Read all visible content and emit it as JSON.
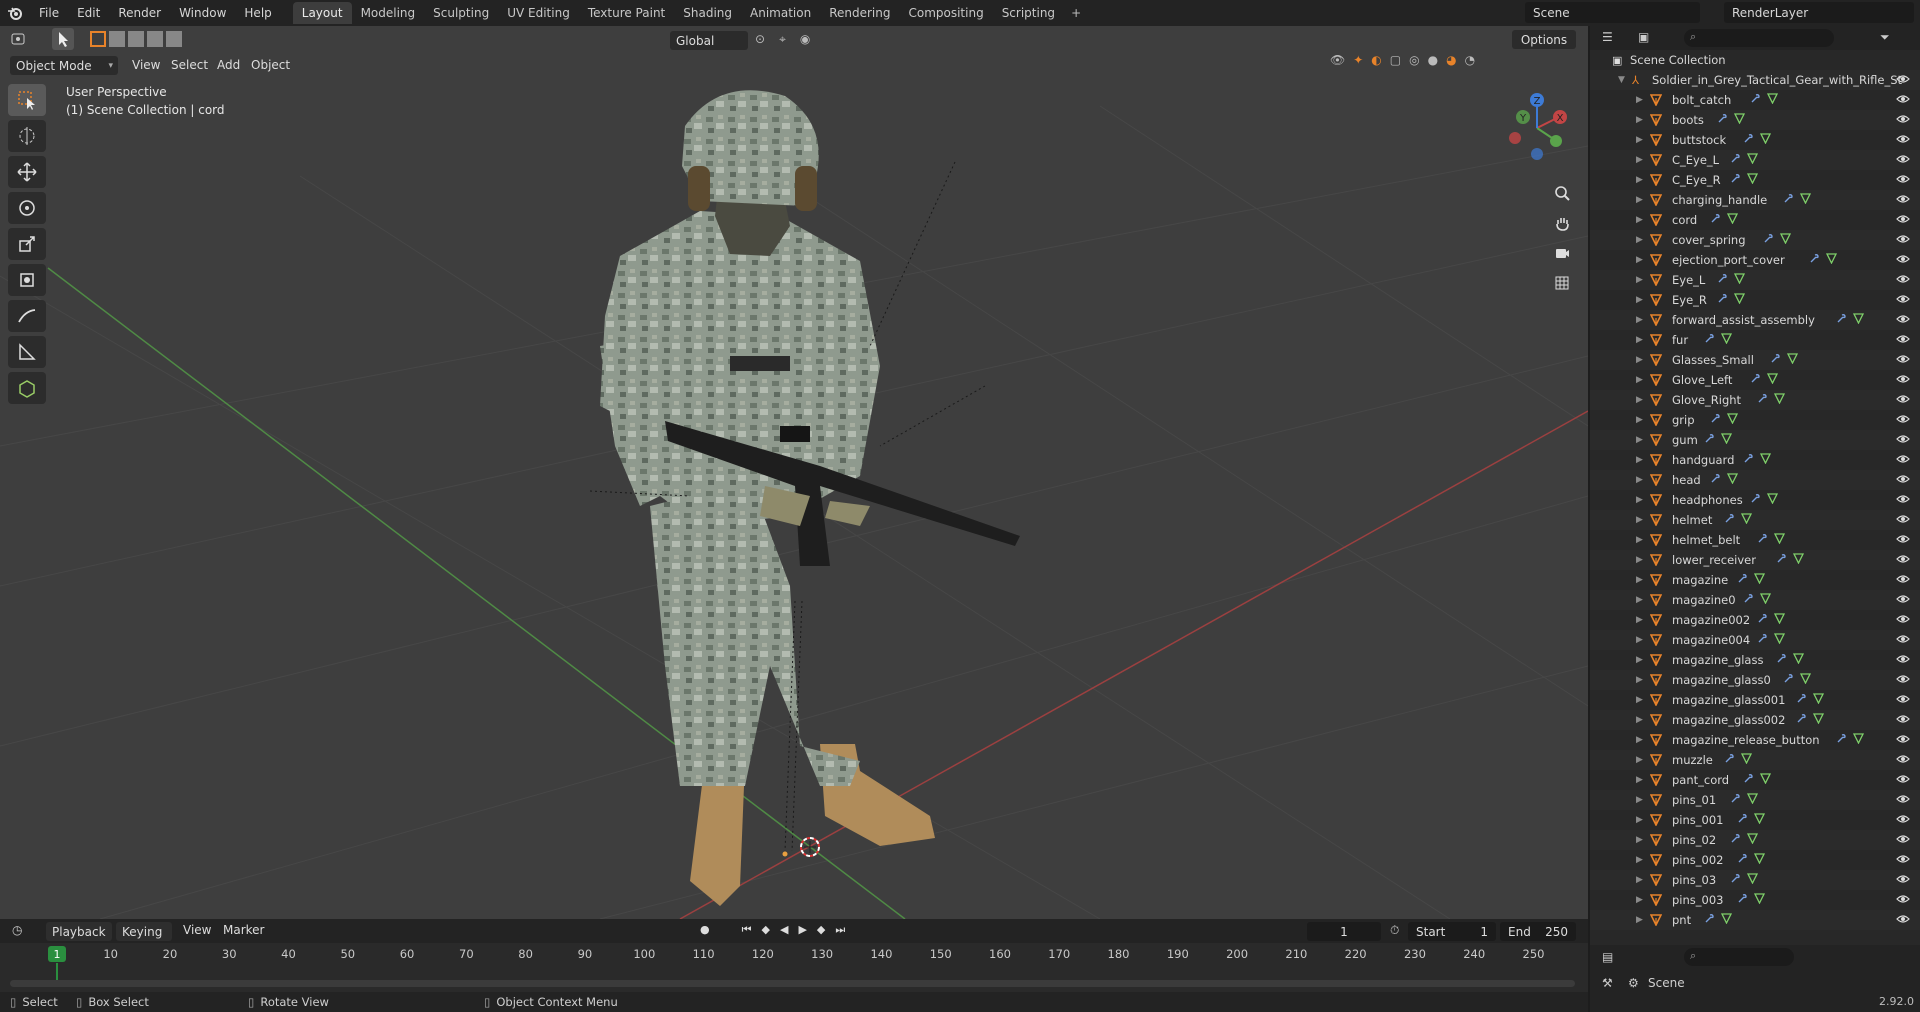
{
  "top_menu": [
    "File",
    "Edit",
    "Render",
    "Window",
    "Help"
  ],
  "workspace_tabs": [
    "Layout",
    "Modeling",
    "Sculpting",
    "UV Editing",
    "Texture Paint",
    "Shading",
    "Animation",
    "Rendering",
    "Compositing",
    "Scripting"
  ],
  "active_tab": "Layout",
  "scene_name": "Scene",
  "render_layer": "RenderLayer",
  "viewport": {
    "mode": "Object Mode",
    "menus": [
      "View",
      "Select",
      "Add",
      "Object"
    ],
    "transform_orientation": "Global",
    "options_label": "Options",
    "perspective_label": "User Perspective",
    "collection_label": "(1) Scene Collection | cord"
  },
  "gizmo_axes": {
    "x": "X",
    "y": "Y",
    "z": "Z"
  },
  "outliner": {
    "root": "Scene Collection",
    "parent": "Soldier_in_Grey_Tactical_Gear_with_Rifle_St",
    "items": [
      "bolt_catch",
      "boots",
      "buttstock",
      "C_Eye_L",
      "C_Eye_R",
      "charging_handle",
      "cord",
      "cover_spring",
      "ejection_port_cover",
      "Eye_L",
      "Eye_R",
      "forward_assist_assembly",
      "fur",
      "Glasses_Small",
      "Glove_Left",
      "Glove_Right",
      "grip",
      "gum",
      "handguard",
      "head",
      "headphones",
      "helmet",
      "helmet_belt",
      "lower_receiver",
      "magazine",
      "magazine0",
      "magazine002",
      "magazine004",
      "magazine_glass",
      "magazine_glass0",
      "magazine_glass001",
      "magazine_glass002",
      "magazine_release_button",
      "muzzle",
      "pant_cord",
      "pins_01",
      "pins_001",
      "pins_02",
      "pins_002",
      "pins_03",
      "pins_003",
      "pnt"
    ]
  },
  "properties": {
    "scene_label": "Scene"
  },
  "version": "2.92.0",
  "timeline": {
    "menus": [
      "Playback",
      "Keying",
      "View",
      "Marker"
    ],
    "current_frame": "1",
    "start_label": "Start",
    "start": "1",
    "end_label": "End",
    "end": "250",
    "ticks": [
      "10",
      "20",
      "30",
      "40",
      "50",
      "60",
      "70",
      "80",
      "90",
      "100",
      "110",
      "120",
      "130",
      "140",
      "150",
      "160",
      "170",
      "180",
      "190",
      "200",
      "210",
      "220",
      "230",
      "240",
      "250"
    ],
    "cursor_label": "1"
  },
  "status": {
    "select": "Select",
    "box_select": "Box Select",
    "rotate": "Rotate View",
    "context": "Object Context Menu"
  },
  "colors": {
    "accent_orange": "#e8832a",
    "x_axis": "#c24545",
    "y_axis": "#5aa34b",
    "z_axis": "#3d7bd6",
    "viewport_bg": "#3e3e3e"
  }
}
